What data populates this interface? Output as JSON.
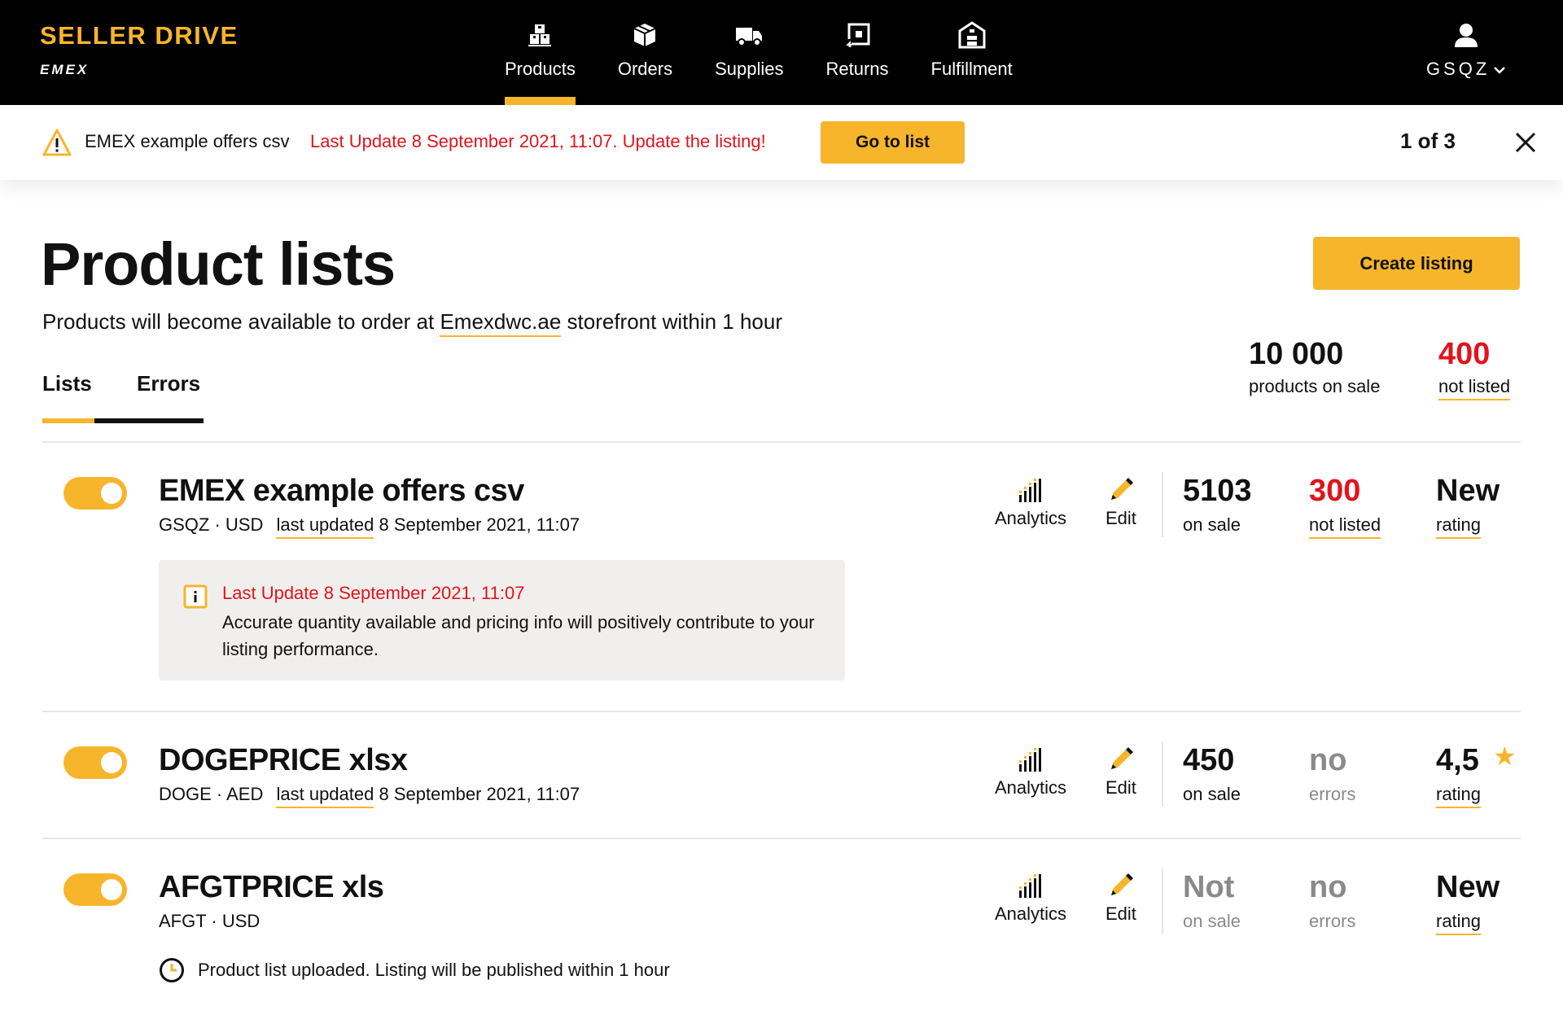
{
  "brand": {
    "name": "SELLER DRIVE",
    "sub": "EMEX"
  },
  "nav": [
    {
      "label": "Products",
      "icon": "products-icon",
      "active": true
    },
    {
      "label": "Orders",
      "icon": "orders-box-icon"
    },
    {
      "label": "Supplies",
      "icon": "truck-icon"
    },
    {
      "label": "Returns",
      "icon": "returns-icon"
    },
    {
      "label": "Fulfillment",
      "icon": "warehouse-icon"
    }
  ],
  "user": {
    "name": "GSQZ",
    "icon": "user-icon"
  },
  "notice": {
    "file": "EMEX example offers csv",
    "message": "Last Update 8 September 2021, 11:07. Update the listing!",
    "button": "Go to list",
    "counter": "1 of 3"
  },
  "header": {
    "title": "Product lists",
    "sub_before": "Products will become available to order at ",
    "sub_link": "Emexdwc.ae",
    "sub_after": " storefront within 1 hour",
    "create_button": "Create listing"
  },
  "summary": {
    "on_sale_value": "10 000",
    "on_sale_label": "products on sale",
    "not_listed_value": "400",
    "not_listed_label": "not listed"
  },
  "tabs": [
    {
      "label": "Lists",
      "active": true
    },
    {
      "label": "Errors"
    }
  ],
  "actions": {
    "analytics": "Analytics",
    "edit": "Edit"
  },
  "lists": [
    {
      "title": "EMEX example offers csv",
      "meta": "GSQZ · USD",
      "updated_label": "last updated",
      "updated_at": "8 September 2021, 11:07",
      "stat1_value": "5103",
      "stat1_label": "on sale",
      "stat2_value": "300",
      "stat2_label": "not listed",
      "stat3_value": "New",
      "stat3_label": "rating",
      "info_title": "Last Update 8 September 2021, 11:07",
      "info_text": "Accurate quantity available and pricing info will positively contribute to your listing performance."
    },
    {
      "title": "DOGEPRICE xlsx",
      "meta": "DOGE · AED",
      "updated_label": "last updated",
      "updated_at": "8 September 2021, 11:07",
      "stat1_value": "450",
      "stat1_label": "on sale",
      "stat2_value": "no",
      "stat2_label": "errors",
      "stat3_value": "4,5",
      "stat3_label": "rating",
      "star": "★"
    },
    {
      "title": "AFGTPRICE xls",
      "meta": "AFGT · USD",
      "stat1_value": "Not",
      "stat1_label": "on sale",
      "stat2_value": "no",
      "stat2_label": "errors",
      "stat3_value": "New",
      "stat3_label": "rating",
      "pending_text": "Product list uploaded. Listing will be published within 1 hour"
    }
  ],
  "colors": {
    "accent": "#f7b52c",
    "error": "#e0141e",
    "muted": "#8a8a8a",
    "bar": "#000000"
  }
}
